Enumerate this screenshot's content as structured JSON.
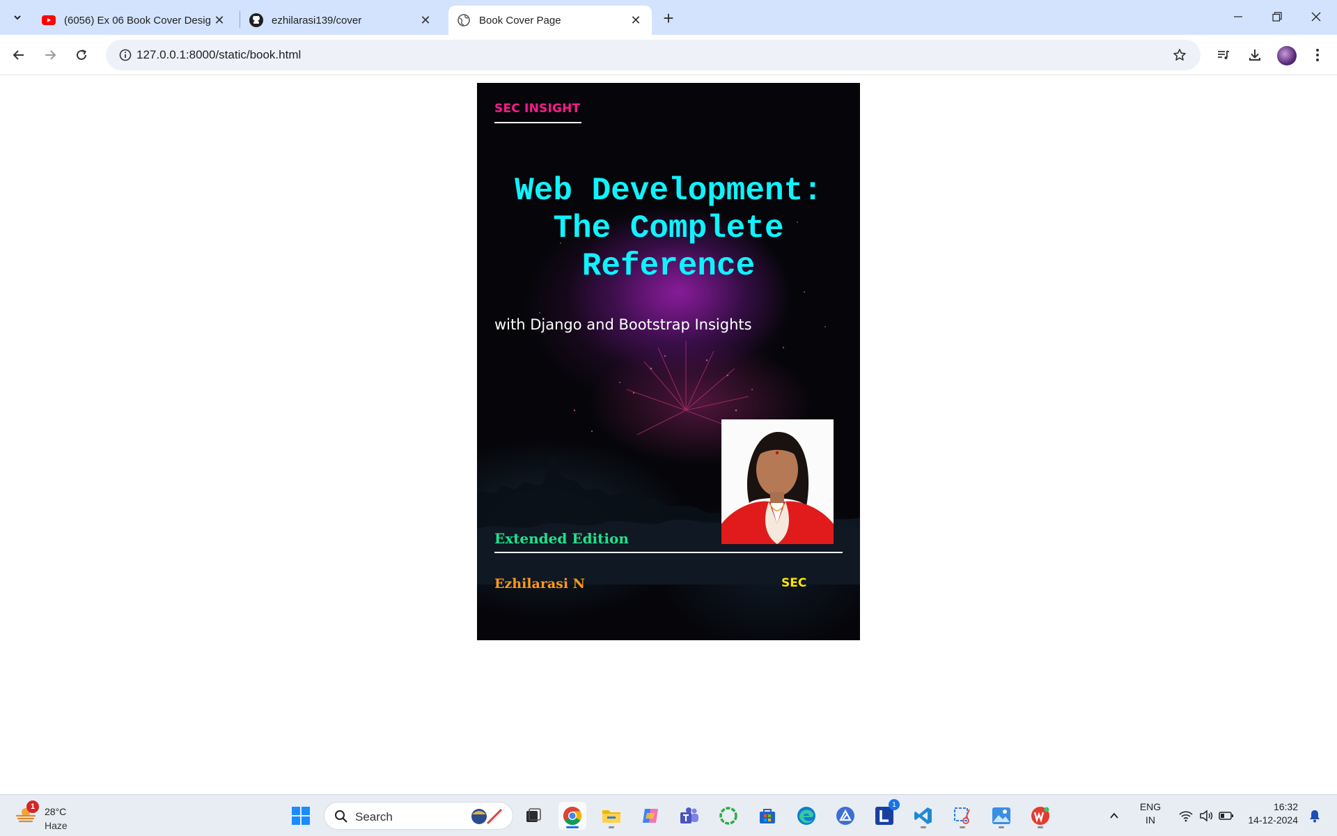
{
  "browser": {
    "tabs": [
      {
        "title": "(6056) Ex 06 Book Cover Design",
        "icon": "youtube-icon",
        "active": false
      },
      {
        "title": "ezhilarasi139/cover",
        "icon": "github-icon",
        "active": false
      },
      {
        "title": "Book Cover Page",
        "icon": "globe-icon",
        "active": true
      }
    ],
    "url": "127.0.0.1:8000/static/book.html"
  },
  "cover": {
    "brand": "SEC INSIGHT",
    "title": "Web Development: The Complete Reference",
    "subtitle": "with Django and Bootstrap Insights",
    "edition": "Extended Edition",
    "author": "Ezhilarasi N",
    "publisher": "SEC"
  },
  "colors": {
    "brand": "#ff1a8c",
    "title": "#0ff3ff",
    "edition": "#20e28c",
    "author": "#ff9a16",
    "publisher": "#ffe400"
  },
  "taskbar": {
    "weather": {
      "badge": "1",
      "temp": "28°C",
      "condition": "Haze"
    },
    "search_label": "Search",
    "apps": [
      "task-view",
      "chrome",
      "file-explorer",
      "copilot",
      "teams",
      "circle-app",
      "store",
      "edge",
      "affinity",
      "l-app",
      "vscode",
      "snipping-tool",
      "photos",
      "wps-office"
    ],
    "l_app_badge": "1",
    "language": {
      "line1": "ENG",
      "line2": "IN"
    },
    "time": "16:32",
    "date": "14-12-2024"
  }
}
